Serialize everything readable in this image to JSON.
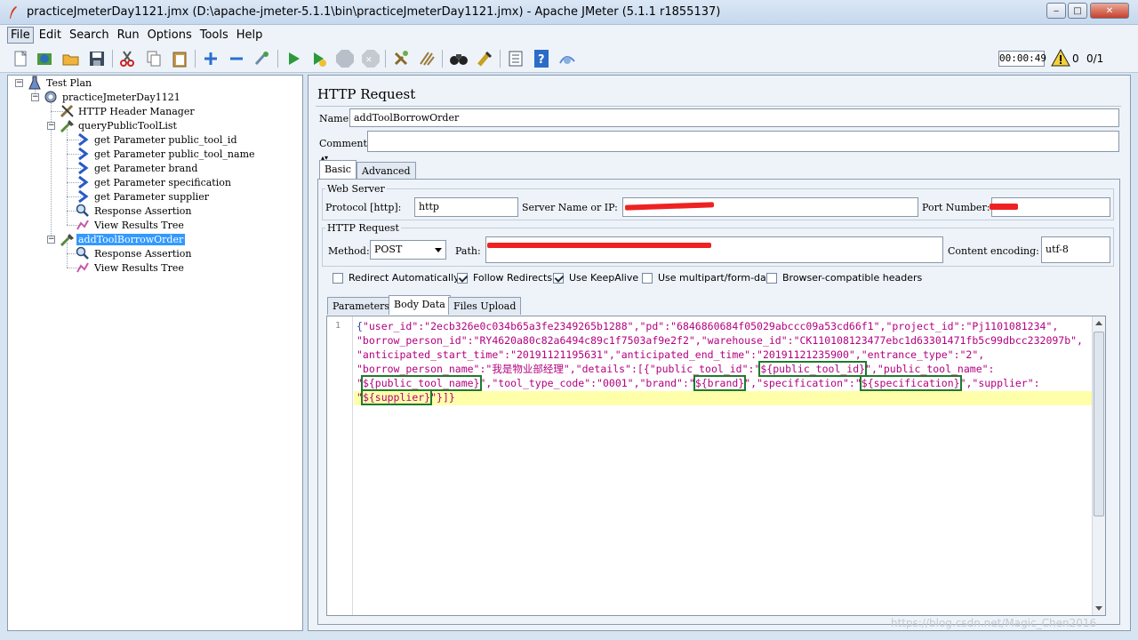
{
  "window": {
    "title": "practiceJmeterDay1121.jmx (D:\\apache-jmeter-5.1.1\\bin\\practiceJmeterDay1121.jmx) - Apache JMeter (5.1.1 r1855137)",
    "minimize": "‒",
    "maximize": "□",
    "close": "✕"
  },
  "menu": [
    "File",
    "Edit",
    "Search",
    "Run",
    "Options",
    "Tools",
    "Help"
  ],
  "status": {
    "timer": "00:00:49",
    "warnings": "0",
    "threads": "0/1"
  },
  "tree": [
    {
      "label": "Test Plan",
      "icon": "test-plan-icon"
    },
    {
      "label": "practiceJmeterDay1121",
      "icon": "thread-group-icon"
    },
    {
      "label": "HTTP Header Manager",
      "icon": "header-manager-icon"
    },
    {
      "label": "queryPublicToolList",
      "icon": "http-sampler-icon"
    },
    {
      "label": "get Parameter public_tool_id",
      "icon": "extractor-icon"
    },
    {
      "label": "get Parameter public_tool_name",
      "icon": "extractor-icon"
    },
    {
      "label": "get Parameter brand",
      "icon": "extractor-icon"
    },
    {
      "label": "get Parameter specification",
      "icon": "extractor-icon"
    },
    {
      "label": "get Parameter supplier",
      "icon": "extractor-icon"
    },
    {
      "label": "Response Assertion",
      "icon": "assertion-icon"
    },
    {
      "label": "View Results Tree",
      "icon": "listener-icon"
    },
    {
      "label": "addToolBorrowOrder",
      "icon": "http-sampler-icon",
      "selected": true
    },
    {
      "label": "Response Assertion",
      "icon": "assertion-icon"
    },
    {
      "label": "View Results Tree",
      "icon": "listener-icon"
    }
  ],
  "panel": {
    "title": "HTTP Request",
    "name_label": "Name:",
    "name_value": "addToolBorrowOrder",
    "comments_label": "Comments:",
    "tabs": {
      "basic": "Basic",
      "advanced": "Advanced"
    },
    "web_server": {
      "title": "Web Server",
      "protocol_label": "Protocol [http]:",
      "protocol_value": "http",
      "server_label": "Server Name or IP:",
      "port_label": "Port Number:"
    },
    "http_request": {
      "title": "HTTP Request",
      "method_label": "Method:",
      "method_value": "POST",
      "path_label": "Path:",
      "encoding_label": "Content encoding:",
      "encoding_value": "utf-8"
    },
    "options": [
      {
        "label": "Redirect Automatically",
        "checked": false
      },
      {
        "label": "Follow Redirects",
        "checked": true
      },
      {
        "label": "Use KeepAlive",
        "checked": true
      },
      {
        "label": "Use multipart/form-data",
        "checked": false
      },
      {
        "label": "Browser-compatible headers",
        "checked": false
      }
    ],
    "subtabs": {
      "parameters": "Parameters",
      "body_data": "Body Data",
      "files_upload": "Files Upload"
    },
    "body": {
      "line_number": "1",
      "line1": "\"user_id\":\"2ecb326e0c034b65a3fe2349265b1288\",\"pd\":\"6846860684f05029abccc09a53cd66f1\",\"project_id\":\"Pj1101081234\",",
      "line2": "\"borrow_person_id\":\"RY4620a80c82a6494c89c1f7503af9e2f2\",\"warehouse_id\":\"CK110108123477ebc1d63301471fb5c99dbcc232097b\",",
      "line3": "\"anticipated_start_time\":\"20191121195631\",\"anticipated_end_time\":\"20191121235900\",\"entrance_type\":\"2\",",
      "line4_a": "\"borrow_person_name\":\"我是物业部经理\",\"details\":[{\"public_tool_id\":\"",
      "var_public_tool_id": "${public_tool_id}",
      "line4_b": "\",\"public_tool_name\":",
      "var_public_tool_name": "${public_tool_name}",
      "line5_a": "\",\"tool_type_code\":\"0001\",\"brand\":\"",
      "var_brand": "${brand}",
      "line5_b": "\",\"specification\":\"",
      "var_specification": "${specification}",
      "line5_c": "\",\"supplier\":",
      "var_supplier": "${supplier}",
      "line6_end": "\"}]}"
    }
  },
  "watermark": "https://blog.csdn.net/Magic_Chen2016"
}
